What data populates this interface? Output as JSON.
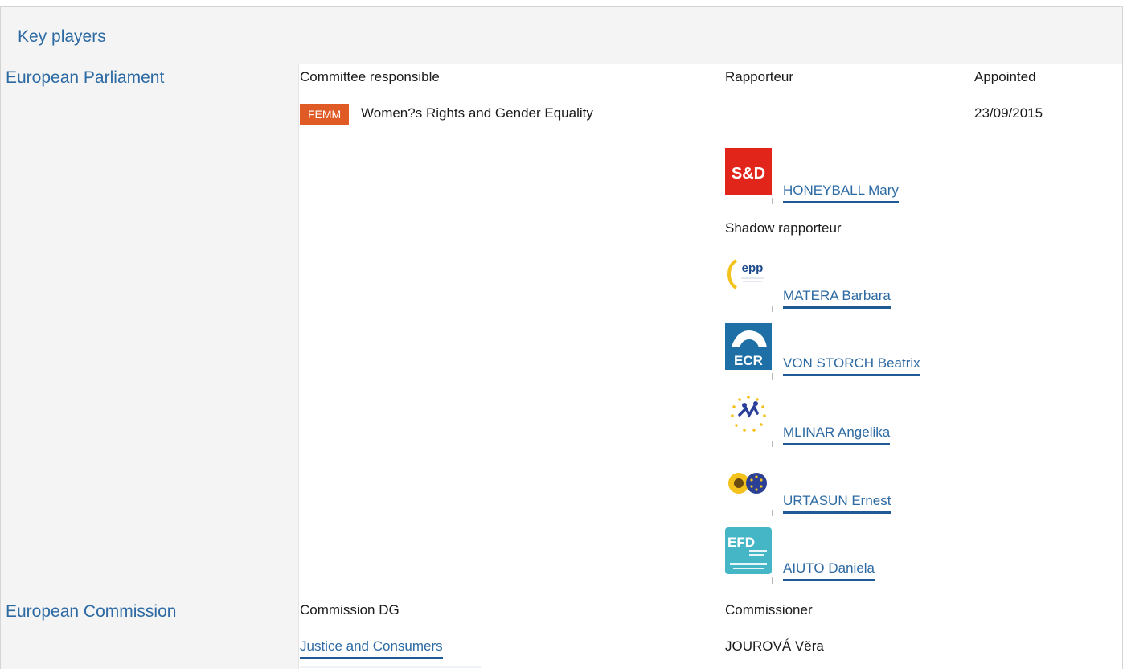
{
  "section": {
    "title": "Key players"
  },
  "parliament": {
    "label": "European Parliament",
    "columns": {
      "committee": "Committee responsible",
      "rapporteur": "Rapporteur",
      "appointed": "Appointed"
    },
    "committee": {
      "badge": "FEMM",
      "badge_color": "#e05a26",
      "name": "Women?s Rights and Gender Equality",
      "appointed": "23/09/2015"
    },
    "rapporteur": {
      "group_logo": "s-and-d-logo",
      "name": "HONEYBALL Mary"
    },
    "shadow_label": "Shadow rapporteur",
    "shadows": [
      {
        "group_logo": "epp-logo",
        "name": "MATERA Barbara"
      },
      {
        "group_logo": "ecr-logo",
        "name": "VON STORCH Beatrix"
      },
      {
        "group_logo": "alde-logo",
        "name": "MLINAR Angelika"
      },
      {
        "group_logo": "greens-efa-logo",
        "name": "URTASUN Ernest"
      },
      {
        "group_logo": "efdd-logo",
        "name": "AIUTO Daniela"
      }
    ]
  },
  "commission": {
    "label": "European Commission",
    "columns": {
      "dg": "Commission DG",
      "commissioner": "Commissioner"
    },
    "dg": "Justice and Consumers",
    "commissioner": "JOUROVÁ Věra"
  },
  "logo_text": {
    "sd": "S&D",
    "epp": "epp",
    "ecr": "ECR",
    "efd": "EFD"
  },
  "colors": {
    "link": "#2d6aa3",
    "link_underline": "#1f5a95",
    "sd_red": "#e1251b",
    "ecr_blue": "#1d6fa5",
    "efd_teal": "#44b6c6"
  }
}
